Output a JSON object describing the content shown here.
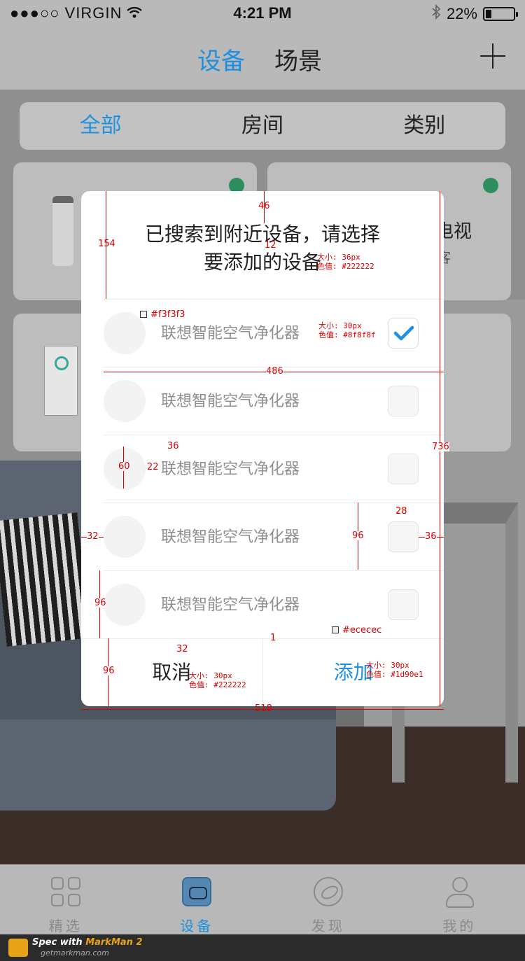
{
  "status_bar": {
    "carrier": "●●●○○ VIRGIN",
    "time": "4:21 PM",
    "battery": "22%",
    "battery_level": 0.22
  },
  "nav": {
    "tab_active": "设备",
    "tab_inactive": "场景"
  },
  "filter": {
    "all": "全部",
    "room": "房间",
    "category": "类别"
  },
  "cards": [
    {
      "name": "",
      "sub": ""
    },
    {
      "name": "电视",
      "sub": "客"
    }
  ],
  "dialog": {
    "title_line1": "已搜索到附近设备，请选择",
    "title_line2": "要添加的设备",
    "items": [
      {
        "label": "联想智能空气净化器",
        "checked": true
      },
      {
        "label": "联想智能空气净化器",
        "checked": false
      },
      {
        "label": "联想智能空气净化器",
        "checked": false
      },
      {
        "label": "联想智能空气净化器",
        "checked": false
      },
      {
        "label": "联想智能空气净化器",
        "checked": false
      }
    ],
    "cancel": "取消",
    "add": "添加"
  },
  "tabbar": {
    "t1": "精选",
    "t2": "设备",
    "t3": "发现",
    "t4": "我的"
  },
  "footer": {
    "line1_prefix": "Spec with ",
    "line1_brand": "MarkMan 2",
    "line2": "getmarkman.com"
  },
  "annotations": {
    "a46": "46",
    "a154": "154",
    "a12": "12",
    "title_spec_size": "大小: 36px",
    "title_spec_color": "色值: #222222",
    "avatar_color": "#f3f3f3",
    "item_spec_size": "大小: 30px",
    "item_spec_color": "色值: #8f8f8f",
    "a486": "486",
    "a36a": "36",
    "a60": "60",
    "a22": "22",
    "a736": "736",
    "a32": "32",
    "a96a": "96",
    "a28": "28",
    "a36b": "36",
    "a96b": "96",
    "divider_color": "#ececec",
    "a1": "1",
    "a32b": "32",
    "a96c": "96",
    "cancel_spec_size": "大小: 30px",
    "cancel_spec_color": "色值: #222222",
    "add_spec_size": "大小: 30px",
    "add_spec_color": "色值: #1d90e1",
    "a518": "518"
  },
  "colors": {
    "accent": "#1d90e1",
    "text": "#222222",
    "muted": "#8f8f8f",
    "divider": "#ececec",
    "avatar": "#f3f3f3"
  }
}
